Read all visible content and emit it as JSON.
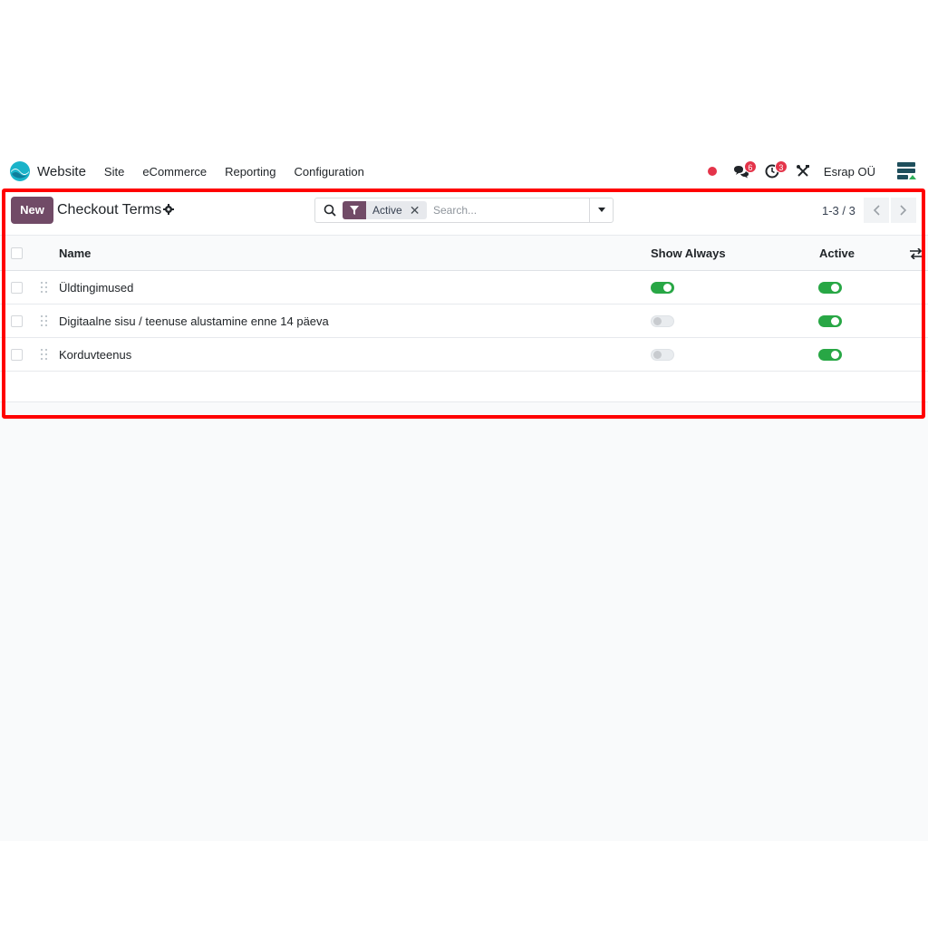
{
  "navbar": {
    "app_name": "Website",
    "menu": [
      "Site",
      "eCommerce",
      "Reporting",
      "Configuration"
    ],
    "messages_badge": "6",
    "activities_badge": "3",
    "company": "Esrap OÜ"
  },
  "control_panel": {
    "new_label": "New",
    "title": "Checkout Terms",
    "search": {
      "facet": "Active",
      "placeholder": "Search..."
    },
    "pager": "1-3 / 3"
  },
  "list": {
    "columns": {
      "name": "Name",
      "show_always": "Show Always",
      "active": "Active"
    },
    "rows": [
      {
        "name": "Üldtingimused",
        "show_always": true,
        "active": true
      },
      {
        "name": "Digitaalne sisu / teenuse alustamine enne 14 päeva",
        "show_always": false,
        "active": true
      },
      {
        "name": "Korduvteenus",
        "show_always": false,
        "active": true
      }
    ]
  },
  "colors": {
    "brand": "#714b67",
    "toggle_on": "#28a745",
    "badge": "#e4344a",
    "highlight": "#ff0000"
  }
}
